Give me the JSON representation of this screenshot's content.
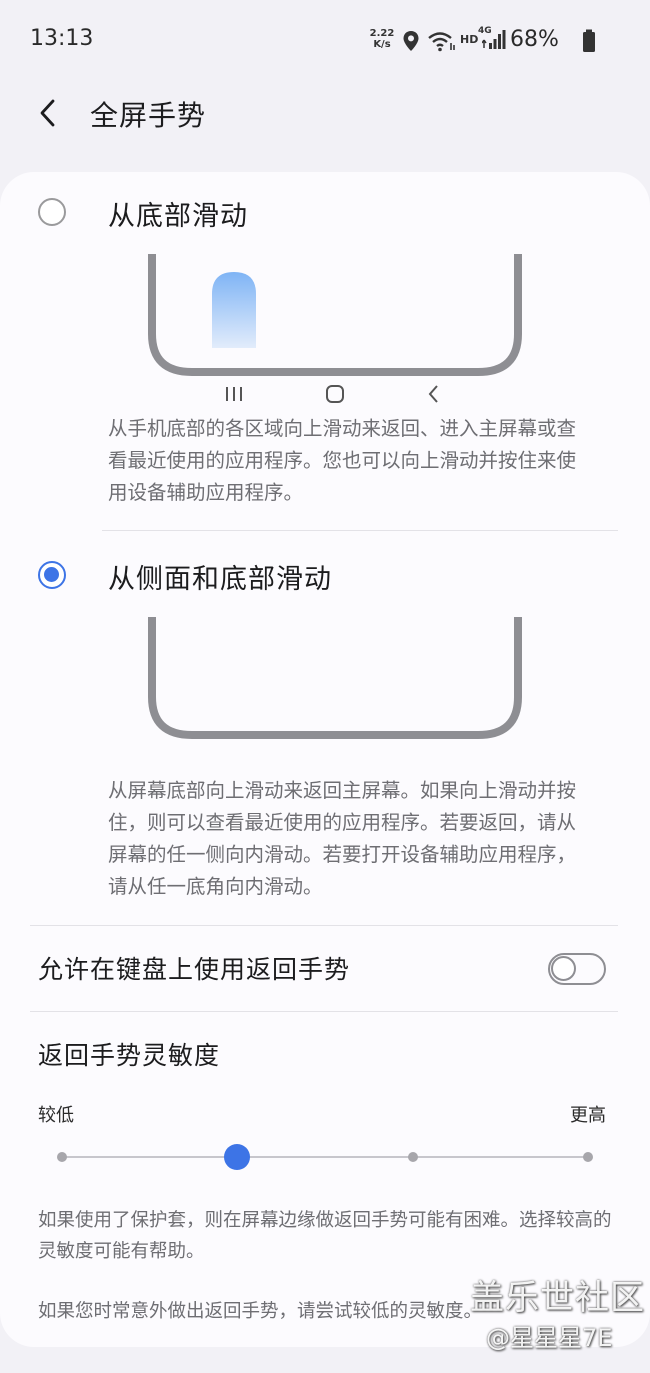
{
  "status_bar": {
    "time": "13:13",
    "net_speed_value": "2.22",
    "net_speed_unit": "K/s",
    "network_labels": {
      "hd": "HD",
      "lte": "4G"
    },
    "battery_percent": "68%",
    "icons": [
      "location-icon",
      "wifi-icon",
      "signal-icon",
      "battery-icon"
    ]
  },
  "header": {
    "back_icon": "chevron-left-icon",
    "title": "全屏手势"
  },
  "options": [
    {
      "label": "从底部滑动",
      "selected": false,
      "description": "从手机底部的各区域向上滑动来返回、进入主屏幕或查看最近使用的应用程序。您也可以向上滑动并按住来使用设备辅助应用程序。",
      "nav_icons": [
        "recents-icon",
        "home-icon",
        "back-icon"
      ]
    },
    {
      "label": "从侧面和底部滑动",
      "selected": true,
      "description": "从屏幕底部向上滑动来返回主屏幕。如果向上滑动并按住，则可以查看最近使用的应用程序。若要返回，请从屏幕的任一侧向内滑动。若要打开设备辅助应用程序，请从任一底角向内滑动。"
    }
  ],
  "keyboard_back_gesture": {
    "label": "允许在键盘上使用返回手势",
    "enabled": false
  },
  "sensitivity": {
    "title": "返回手势灵敏度",
    "low_label": "较低",
    "high_label": "更高",
    "levels": 4,
    "selected_level": 2
  },
  "notes": {
    "case_note": "如果使用了保护套，则在屏幕边缘做返回手势可能有困难。选择较高的灵敏度可能有帮助。",
    "accidental_note": "如果您时常意外做出返回手势，请尝试较低的灵敏度。"
  },
  "watermark": {
    "title": "盖乐世社区",
    "author": "@星星星7E"
  },
  "colors": {
    "accent": "#3d74e6",
    "background": "#f2f1f6",
    "card": "#fcfbfe",
    "secondary_text": "#6e6e73",
    "gesture_bar_top": "#7fb4f5",
    "gesture_bar_bottom": "#e2ecfb"
  }
}
